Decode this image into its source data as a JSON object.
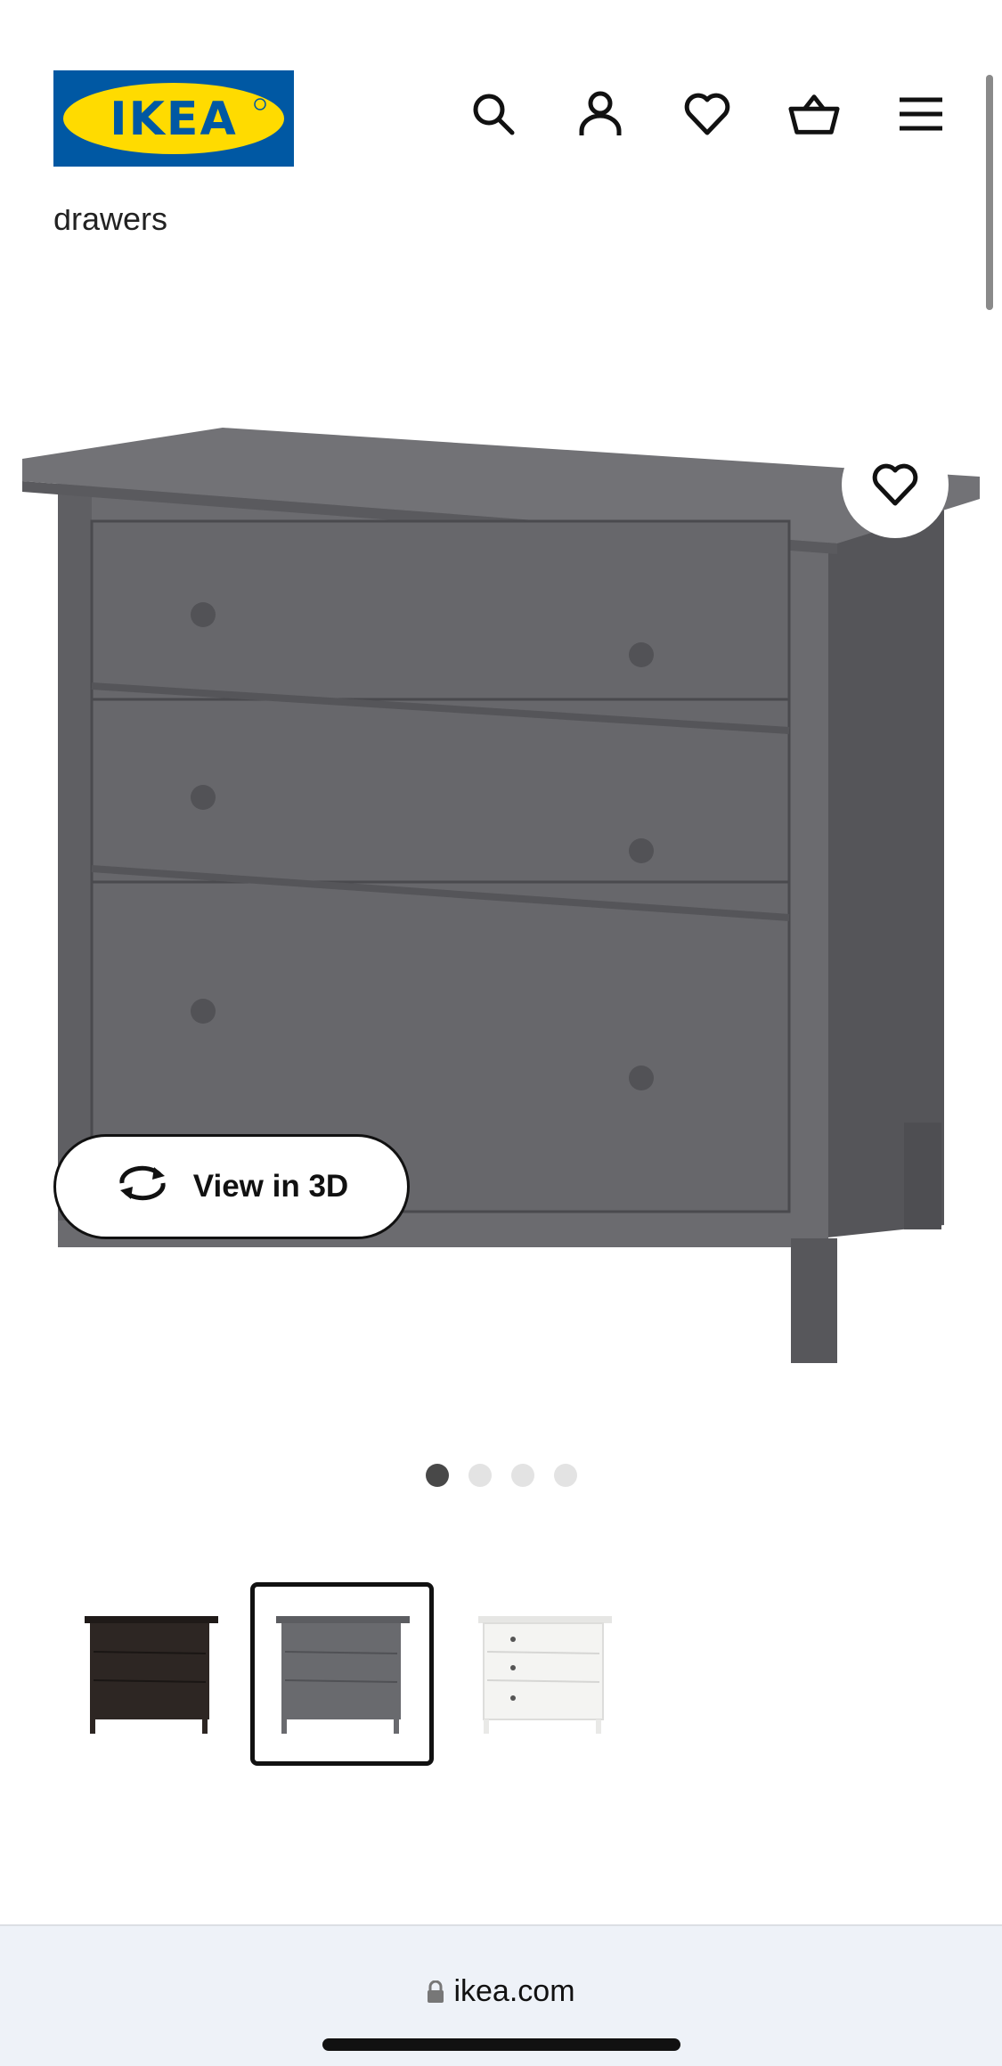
{
  "header": {
    "logo_text": "IKEA",
    "partial_text": "drawers",
    "icons": [
      "search-icon",
      "user-icon",
      "heart-icon",
      "basket-icon",
      "menu-icon"
    ],
    "brand_colors": {
      "blue": "#0058a3",
      "yellow": "#ffdb00"
    }
  },
  "product": {
    "view_3d_label": "View in 3D",
    "image_count": 4,
    "active_image_index": 0,
    "colors": {
      "wood": "#6b6b6e",
      "wood_dark": "#55555a"
    }
  },
  "variants": [
    {
      "color_name": "black-brown",
      "swatch": "#2d2623",
      "selected": false
    },
    {
      "color_name": "dark gray stained",
      "swatch": "#696a6e",
      "selected": true
    },
    {
      "color_name": "white stain",
      "swatch": "#f4f4f2",
      "selected": false
    }
  ],
  "browser": {
    "url": "ikea.com"
  }
}
